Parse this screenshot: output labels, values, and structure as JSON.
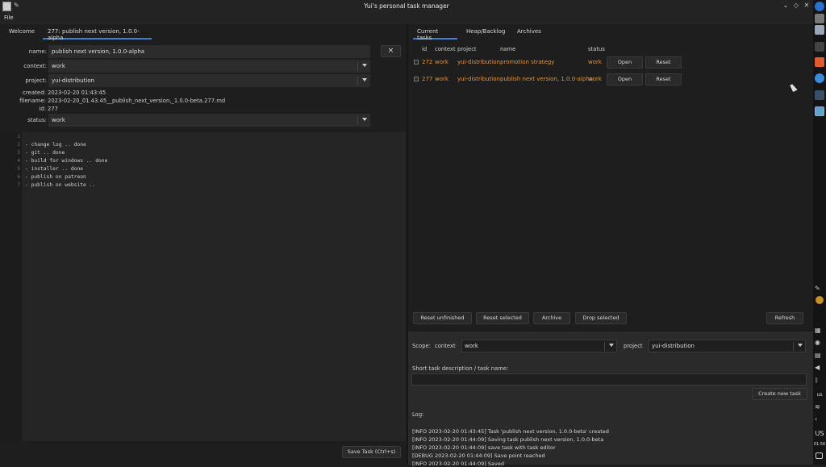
{
  "window": {
    "title": "Yui's personal task manager"
  },
  "menu": {
    "file": "File"
  },
  "left_tabs": [
    "Welcome",
    "277: publish next version, 1.0.0-alpha"
  ],
  "form": {
    "name_label": "name:",
    "name_value": "publish next version, 1.0.0-alpha",
    "close": "×",
    "context_label": "context:",
    "context_value": "work",
    "project_label": "project:",
    "project_value": "yui-distribution",
    "created_label": "created:",
    "created_value": "2023-02-20 01:43:45",
    "filename_label": "filename:",
    "filename_value": "2023-02-20_01.43.45__publish_next_version,_1.0.0-beta.277.md",
    "id_label": "id:",
    "id_value": "277",
    "status_label": "status:",
    "status_value": "work"
  },
  "editor": {
    "line_numbers": [
      "1",
      "2",
      "3",
      "4",
      "5",
      "6",
      "7"
    ],
    "lines": [
      "",
      "- change log .. done",
      "- git .. done",
      "- build for windows .. done",
      "- installer .. done",
      "- publish on patreon",
      "- publish on website .."
    ]
  },
  "save_button": "Save Task (Ctrl+s)",
  "right_tabs": [
    "Current tasks",
    "Heap/Backlog",
    "Archives"
  ],
  "table": {
    "headers": [
      "id",
      "context",
      "project",
      "name",
      "status"
    ],
    "rows": [
      {
        "id": "272",
        "context": "work",
        "project": "yui-distribution",
        "name": "promotion strategy",
        "status": "work",
        "open": "Open",
        "reset": "Reset"
      },
      {
        "id": "277",
        "context": "work",
        "project": "yui-distribution",
        "name": "publish next version, 1.0.0-alpha",
        "status": "work",
        "open": "Open",
        "reset": "Reset"
      }
    ],
    "status_color": "#e6952b"
  },
  "actions": {
    "reset_unfinished": "Reset unfinished",
    "reset_selected": "Reset selected",
    "archive": "Archive",
    "drop_selected": "Drop selected",
    "refresh": "Refresh"
  },
  "create": {
    "scope_label": "Scope:",
    "context_label": "context",
    "context_value": "work",
    "project_label": "project",
    "project_value": "yui-distribution",
    "desc_label": "Short task description / task name:",
    "create_button": "Create new task",
    "log_label": "Log:"
  },
  "log": [
    "[INFO 2023-02-20 01:43:45] Task 'publish next version, 1.0.0-beta' created",
    "[INFO 2023-02-20 01:44:09] Saving task publish next version, 1.0.0-beta",
    "[INFO 2023-02-20 01:44:09] save task with task editor",
    "[DEBUG 2023-02-20 01:44:09] Save point reached",
    "[INFO 2023-02-20 01:44:09] Saved"
  ],
  "tray": {
    "keyboard1": "us",
    "keyboard2": "US",
    "time": "01:56"
  },
  "colors": {
    "accent": "#3c7fd4",
    "orange": "#e6952b",
    "bg": "#1e1e1e"
  }
}
